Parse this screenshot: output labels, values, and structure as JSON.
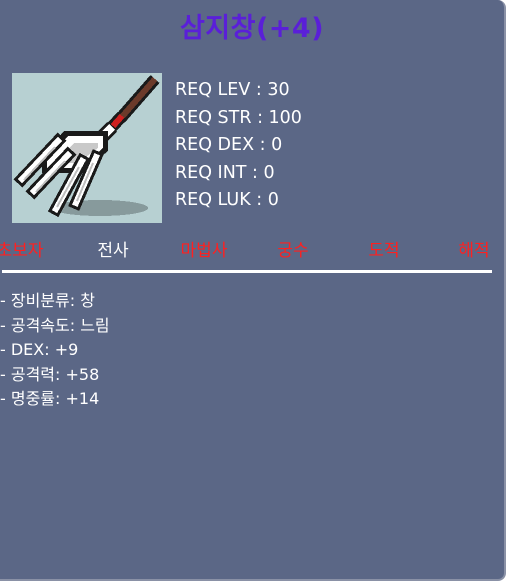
{
  "item": {
    "name": "삼지창(+4)",
    "icon": "trident-icon",
    "colors": {
      "title": "#5a1fd8",
      "background": "#5b6786",
      "icon_background": "#b7d0d2",
      "job_unavailable": "#ff2020",
      "job_available": "#ffffff"
    }
  },
  "requirements": [
    {
      "text": "REQ LEV : 30"
    },
    {
      "text": "REQ STR : 100"
    },
    {
      "text": "REQ DEX : 0"
    },
    {
      "text": "REQ INT : 0"
    },
    {
      "text": "REQ LUK : 0"
    }
  ],
  "jobs": [
    {
      "label": "초보자",
      "available": false
    },
    {
      "label": "전사",
      "available": true
    },
    {
      "label": "마법사",
      "available": false
    },
    {
      "label": "궁수",
      "available": false
    },
    {
      "label": "도적",
      "available": false
    },
    {
      "label": "해적",
      "available": false
    }
  ],
  "stats": [
    {
      "text": "- 장비분류: 창"
    },
    {
      "text": "- 공격속도: 느림"
    },
    {
      "text": "- DEX: +9"
    },
    {
      "text": "- 공격력: +58"
    },
    {
      "text": "- 명중률: +14"
    }
  ]
}
